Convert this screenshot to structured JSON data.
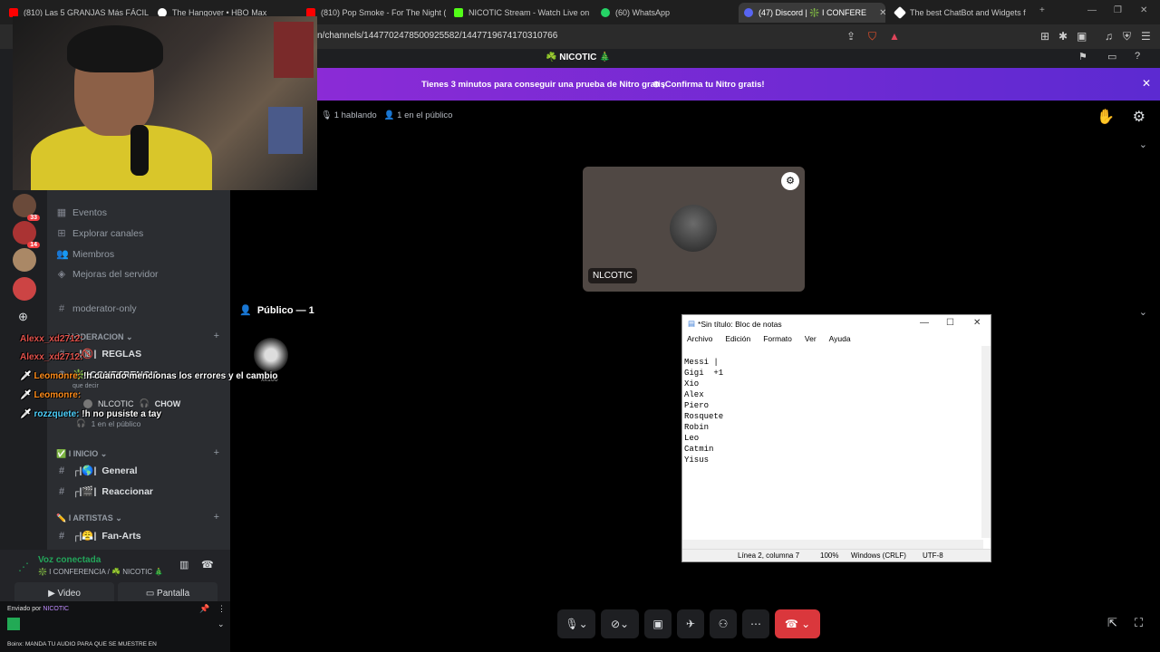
{
  "browser": {
    "tabs": [
      {
        "label": "(810) Las 5 GRANJAS Más FÁCILE",
        "color": "#ff0000"
      },
      {
        "label": "The Hangover • HBO Max",
        "color": "#ffffff"
      },
      {
        "label": "(810) Pop Smoke - For The Night (Vi",
        "color": "#ff0000"
      },
      {
        "label": "NICOTIC Stream - Watch Live on",
        "color": "#53fc18"
      },
      {
        "label": "(60) WhatsApp",
        "color": "#25d366"
      },
      {
        "label": "(47) Discord | ❇️ I CONFERE",
        "color": "#5865f2"
      },
      {
        "label": "The best ChatBot and Widgets for K",
        "color": "#ffffff"
      }
    ],
    "url": "n/channels/1447702478500925582/1447719674170310766"
  },
  "discord": {
    "header_title": "☘️ NICOTIC 🎄",
    "nitro_message": "Tienes 3 minutos para conseguir una prueba de Nitro gratis",
    "nitro_cta": "¡Confirma tu Nitro gratis!",
    "stage_status_speaking": "1 hablando",
    "stage_status_public": "1 en el público",
    "speaker_name": "NLCOTIC",
    "public_header": "Público — 1",
    "listener_name": "xx100",
    "sidebar": {
      "items": [
        {
          "label": "Eventos",
          "icon": "calendar-icon"
        },
        {
          "label": "Explorar canales",
          "icon": "grid-icon"
        },
        {
          "label": "Miembros",
          "icon": "members-icon"
        },
        {
          "label": "Mejoras del servidor",
          "icon": "boost-icon"
        },
        {
          "label": "moderator-only",
          "icon": "hash-icon"
        }
      ],
      "cat_moderacion": "MODERACION",
      "ch_reglas": "REGLAS",
      "ch_conferencia": "CONFERENCIA",
      "stage_user": "NLCOTIC",
      "stage_user_extra": "CHOW",
      "stage_que_decir": "que decir",
      "stage_public": "1 en el público",
      "cat_inicio": "I INICIO",
      "ch_general": "General",
      "ch_reaccionar": "Reaccionar",
      "cat_artistas": "I ARTISTAS",
      "ch_fanarts": "Fan-Arts"
    },
    "guild_badges": [
      "33",
      "14"
    ],
    "voice": {
      "title": "Voz conectada",
      "sub": "❇️ I CONFERENCIA / ☘️ NICOTIC 🎄",
      "video": "Video",
      "screen": "Pantalla"
    },
    "bottom_sent_by": "Enviado por",
    "bottom_sender": "NICOTIC",
    "bottom_text": "Boinx: MANDA TU AUDIO PARA QUE SE MUESTRE EN"
  },
  "chat_overlay": [
    {
      "user": "Alexx_xd2712:",
      "text": "",
      "color": "#e0504a"
    },
    {
      "user": "Alexx_xd2712:",
      "text": "",
      "color": "#e0504a"
    },
    {
      "user": "Leomonre:",
      "text": "!h cuando mencionas los errores y el cambio",
      "color": "#ff8c1a"
    },
    {
      "user": "Leomonre:",
      "text": "",
      "color": "#ff8c1a"
    },
    {
      "user": "rozzquete:",
      "text": "!h no pusiste a tay",
      "color": "#4dd2ff"
    }
  ],
  "notepad": {
    "title": "*Sin título: Bloc de notas",
    "menu": [
      "Archivo",
      "Edición",
      "Formato",
      "Ver",
      "Ayuda"
    ],
    "content": "Messi |\nGigi  +1\nXio\nAlex\nPiero\nRosquete\nRobin\nLeo\nCatmin\nYisus",
    "status": {
      "position": "Línea 2, columna 7",
      "zoom": "100%",
      "line_ending": "Windows (CRLF)",
      "encoding": "UTF-8"
    }
  }
}
